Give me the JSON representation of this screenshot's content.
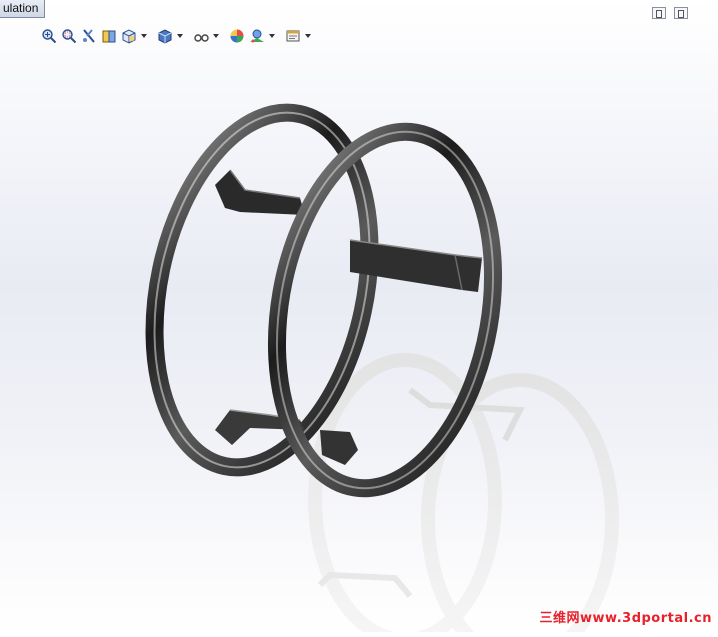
{
  "tab": {
    "label": "ulation"
  },
  "toolbar": {
    "icons": [
      "zoom-to-fit-icon",
      "zoom-to-area-icon",
      "previous-view-icon",
      "section-view-icon",
      "view-orientation-icon",
      "display-style-icon",
      "hide-show-items-icon",
      "edit-appearance-icon",
      "apply-scene-icon",
      "view-settings-icon"
    ]
  },
  "watermark": {
    "text": "三维网www.3dportal.cn"
  },
  "colors": {
    "ring": "#2b2b2b",
    "reflection": "#d8d8d8",
    "watermark": "#e8222a",
    "background": "#eceef5"
  }
}
